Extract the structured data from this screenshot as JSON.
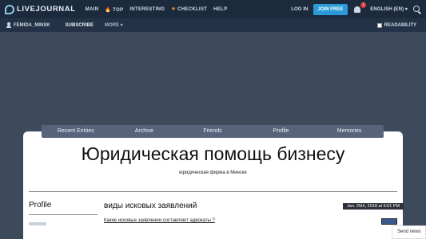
{
  "topnav": {
    "logo": "LIVEJOURNAL",
    "items": [
      "MAIN",
      "TOP",
      "INTERESTING",
      "CHECKLIST",
      "HELP"
    ],
    "login": "LOG IN",
    "join": "JOIN FREE",
    "notifications_count": "1",
    "language": "ENGLISH (EN)"
  },
  "journal_bar": {
    "username": "FEMIDA_MINSK",
    "subscribe": "SUBSCRIBE",
    "more": "MORE",
    "readability": "READABILITY"
  },
  "tabs": [
    "Recent Entries",
    "Archive",
    "Friends",
    "Profile",
    "Memories"
  ],
  "header": {
    "title": "Юридическая помощь бизнесу",
    "subtitle": "юридическая фирма в Минске"
  },
  "sidebar": {
    "heading": "Profile"
  },
  "post": {
    "title": "виды исковых заявлений",
    "date": "Jan. 25th, 2018 at 6:01 PM",
    "link_text": "Какие исковые заявления составляют адвокаты ?"
  },
  "widget": {
    "send_news": "Send news"
  },
  "colors": {
    "topbar": "#1c2a3e",
    "accent": "#2a9ad8",
    "background": "#3d4a5c"
  }
}
